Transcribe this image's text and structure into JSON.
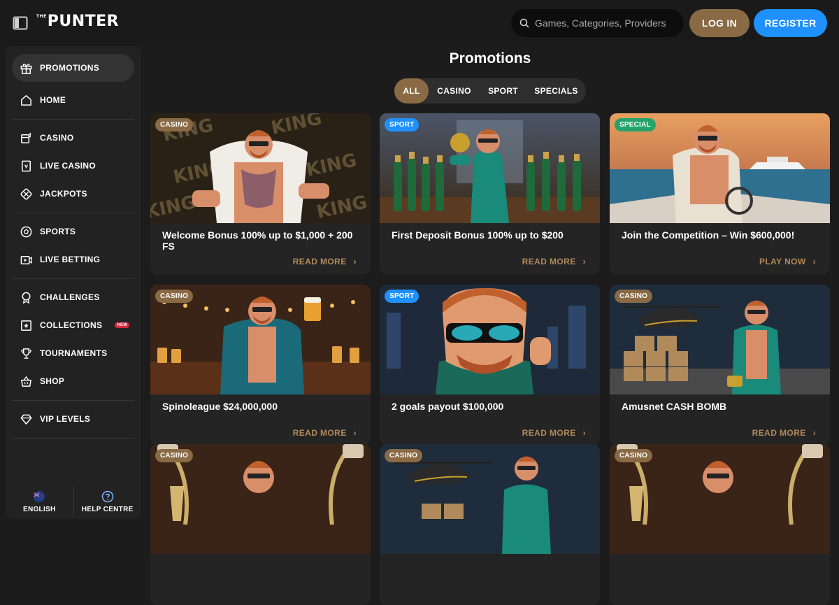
{
  "header": {
    "logo_small": "THE",
    "logo": "PUNTER",
    "search_placeholder": "Games, Categories, Providers",
    "login_label": "LOG IN",
    "register_label": "REGISTER"
  },
  "sidebar": {
    "items": [
      {
        "label": "PROMOTIONS",
        "icon": "gift-icon"
      },
      {
        "label": "HOME",
        "icon": "home-icon"
      },
      {
        "label": "CASINO",
        "icon": "slot-machine-icon"
      },
      {
        "label": "LIVE CASINO",
        "icon": "live-card-icon"
      },
      {
        "label": "JACKPOTS",
        "icon": "jackpot-icon"
      },
      {
        "label": "SPORTS",
        "icon": "soccer-ball-icon"
      },
      {
        "label": "LIVE BETTING",
        "icon": "live-tv-icon"
      },
      {
        "label": "CHALLENGES",
        "icon": "medal-icon"
      },
      {
        "label": "COLLECTIONS",
        "icon": "collection-icon",
        "badge": "NEW"
      },
      {
        "label": "TOURNAMENTS",
        "icon": "trophy-icon"
      },
      {
        "label": "SHOP",
        "icon": "basket-icon"
      },
      {
        "label": "VIP LEVELS",
        "icon": "diamond-icon"
      }
    ],
    "footer": {
      "language_label": "ENGLISH",
      "help_label": "HELP CENTRE"
    }
  },
  "main": {
    "title": "Promotions",
    "filters": [
      "ALL",
      "CASINO",
      "SPORT",
      "SPECIALS"
    ],
    "active_filter": "ALL",
    "cards": [
      {
        "tag": "CASINO",
        "title": "Welcome Bonus 100% up to $1,000 + 200 FS",
        "action": "READ MORE"
      },
      {
        "tag": "SPORT",
        "title": "First Deposit Bonus 100% up to $200",
        "action": "READ MORE"
      },
      {
        "tag": "SPECIAL",
        "title": "Join the Competition – Win $600,000!",
        "action": "PLAY NOW"
      },
      {
        "tag": "CASINO",
        "title": "Spinoleague $24,000,000",
        "action": "READ MORE"
      },
      {
        "tag": "SPORT",
        "title": "2 goals payout $100,000",
        "action": "READ MORE"
      },
      {
        "tag": "CASINO",
        "title": "Amusnet CASH BOMB",
        "action": "READ MORE"
      },
      {
        "tag": "CASINO",
        "title": "",
        "action": ""
      },
      {
        "tag": "CASINO",
        "title": "",
        "action": ""
      },
      {
        "tag": "CASINO",
        "title": "",
        "action": ""
      }
    ]
  },
  "colors": {
    "gold": "#8a6a45",
    "blue": "#1e90ff",
    "green": "#25a36a",
    "badge_red": "#d9253a"
  }
}
